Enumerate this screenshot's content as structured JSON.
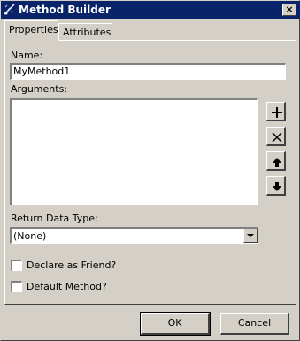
{
  "window": {
    "title": "Method Builder",
    "close_glyph": "×",
    "icon": "method-builder-icon"
  },
  "tabs": [
    {
      "label": "Properties",
      "active": true
    },
    {
      "label": "Attributes",
      "active": false
    }
  ],
  "form": {
    "name_label": "Name:",
    "name_value": "MyMethod1",
    "arguments_label": "Arguments:",
    "arguments_items": [],
    "argument_buttons": [
      {
        "icon": "plus-icon"
      },
      {
        "icon": "delete-x-icon"
      },
      {
        "icon": "arrow-up-icon"
      },
      {
        "icon": "arrow-down-icon"
      }
    ],
    "return_type_label": "Return Data Type:",
    "return_type_value": "(None)",
    "declare_friend_label": "Declare as Friend?",
    "declare_friend_checked": false,
    "default_method_label": "Default Method?",
    "default_method_checked": false
  },
  "buttons": {
    "ok_label": "OK",
    "cancel_label": "Cancel"
  }
}
